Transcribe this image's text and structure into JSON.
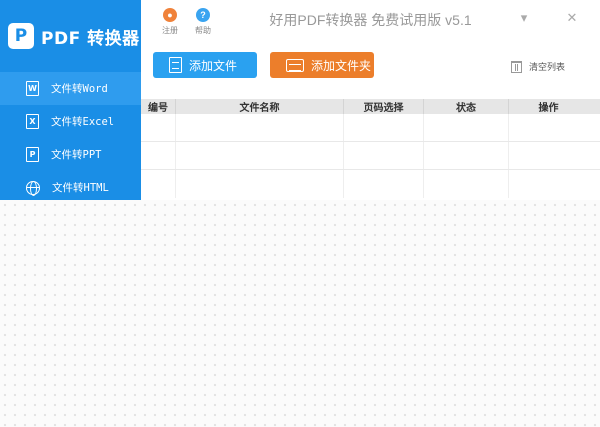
{
  "app": {
    "brand_logo_letter": "P",
    "brand_name": "PDF 转换器",
    "title": "好用PDF转换器 免费试用版 v5.1"
  },
  "titlebar": {
    "register_label": "注册",
    "help_label": "帮助",
    "minimize_glyph": "▾",
    "close_glyph": "✕"
  },
  "sidebar": {
    "items": [
      {
        "label": "文件转Word",
        "icon": "word-doc-icon",
        "glyph": "W",
        "active": true
      },
      {
        "label": "文件转Excel",
        "icon": "excel-doc-icon",
        "glyph": "X",
        "active": false
      },
      {
        "label": "文件转PPT",
        "icon": "ppt-doc-icon",
        "glyph": "P",
        "active": false
      },
      {
        "label": "文件转HTML",
        "icon": "globe-icon",
        "glyph": "",
        "active": false
      }
    ]
  },
  "toolbar": {
    "add_file_label": "添加文件",
    "add_folder_label": "添加文件夹",
    "clear_list_label": "清空列表"
  },
  "table": {
    "columns": [
      "编号",
      "文件名称",
      "页码选择",
      "状态",
      "操作"
    ],
    "rows": []
  },
  "colors": {
    "sidebar": "#1a8ee6",
    "sidebar_active": "#2f9cee",
    "add_file": "#2aa1f0",
    "add_folder": "#ec7e2b",
    "register_icon": "#f0823a",
    "help_icon": "#3aa4f0"
  }
}
